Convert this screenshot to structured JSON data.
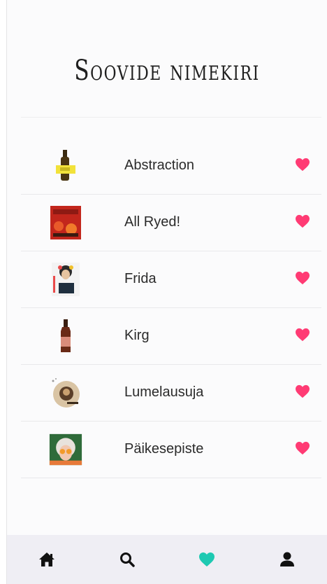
{
  "header": {
    "title": "Soovide nimekiri"
  },
  "wishlist": [
    {
      "name": "Abstraction",
      "thumb_icon": "beer-bottle-yellow-label-icon"
    },
    {
      "name": "All Ryed!",
      "thumb_icon": "red-beer-can-label-icon"
    },
    {
      "name": "Frida",
      "thumb_icon": "frida-portrait-label-icon"
    },
    {
      "name": "Kirg",
      "thumb_icon": "amber-beer-bottle-icon"
    },
    {
      "name": "Lumelausuja",
      "thumb_icon": "round-brown-badge-icon"
    },
    {
      "name": "Päikesepiste",
      "thumb_icon": "woman-sunglasses-label-icon"
    }
  ],
  "colors": {
    "heart": "#ff3b74",
    "active_nav": "#1ec9b2",
    "nav_icon": "#111111",
    "nav_background": "#efeef4"
  },
  "nav": [
    {
      "icon": "home-icon",
      "active": false
    },
    {
      "icon": "search-icon",
      "active": false
    },
    {
      "icon": "heart-icon",
      "active": true
    },
    {
      "icon": "user-icon",
      "active": false
    }
  ]
}
